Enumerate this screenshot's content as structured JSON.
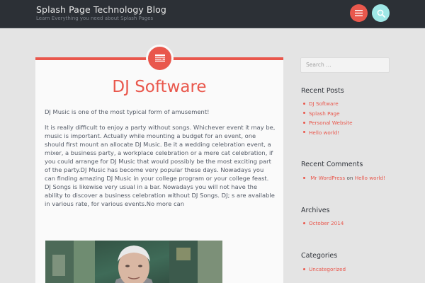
{
  "header": {
    "site_title": "Splash Page Technology Blog",
    "site_description": "Learn Everything you need about Splash Pages",
    "menu_icon": "hamburger-icon",
    "search_icon": "search-icon",
    "colors": {
      "bar": "#2c3036",
      "menu_button": "#e9584d",
      "search_button": "#9fe7e6"
    }
  },
  "post": {
    "badge_icon": "post-format-standard-icon",
    "title": "DJ Software",
    "paragraphs": [
      "DJ Music is one of the most typical form of amusement!",
      "It is really difficult to enjoy a party without songs. Whichever event it may be, music is important. Actually while mounting a budget for an event, one should first mount an allocate DJ Music. Be it a wedding celebration event, a mixer, a business party, a workplace celebration or a mere cat celebration, if you could arrange for DJ Music that would possibly be the most exciting part of the party.DJ Music has become very popular these days. Nowadays you can finding amazing DJ Music in your college program or your college feast. DJ Songs is likewise very usual in a bar. Nowadays you will not have the ability to discover a business celebration without DJ Songs. DJ; s are available in various rate, for various events.No more can"
    ],
    "accent_color": "#e9574c"
  },
  "sidebar": {
    "search_placeholder": "Search …",
    "recent_posts": {
      "title": "Recent Posts",
      "items": [
        "DJ Software",
        "Splash Page",
        "Personal Website",
        "Hello world!"
      ]
    },
    "recent_comments": {
      "title": "Recent Comments",
      "author": "Mr WordPress",
      "connector": "on",
      "post": "Hello world!"
    },
    "archives": {
      "title": "Archives",
      "items": [
        "October 2014"
      ]
    },
    "categories": {
      "title": "Categories",
      "items": [
        "Uncategorized"
      ]
    }
  }
}
